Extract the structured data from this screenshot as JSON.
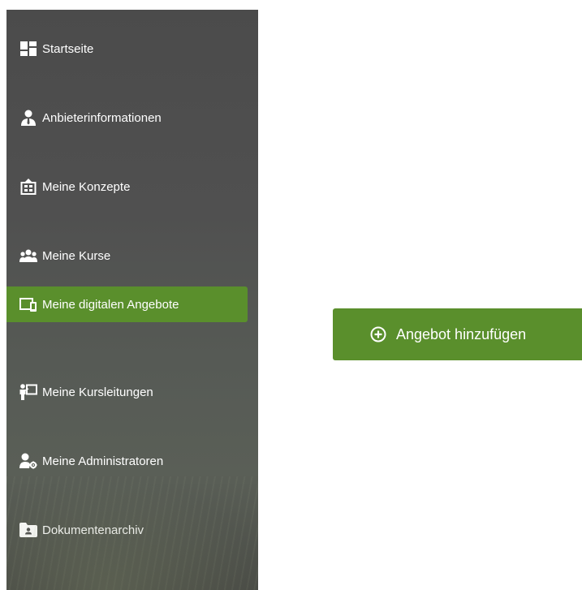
{
  "sidebar": {
    "items": [
      {
        "label": "Startseite",
        "icon": "dashboard-icon",
        "active": false
      },
      {
        "label": "Anbieterinformationen",
        "icon": "user-tie-icon",
        "active": false
      },
      {
        "label": "Meine Konzepte",
        "icon": "building-icon",
        "active": false
      },
      {
        "label": "Meine Kurse",
        "icon": "group-icon",
        "active": false
      },
      {
        "label": "Meine digitalen Angebote",
        "icon": "devices-icon",
        "active": true
      },
      {
        "label": "Meine Kursleitungen",
        "icon": "presenter-icon",
        "active": false
      },
      {
        "label": "Meine Administratoren",
        "icon": "user-gear-icon",
        "active": false
      },
      {
        "label": "Dokumentenarchiv",
        "icon": "folder-id-icon",
        "active": false
      }
    ]
  },
  "main": {
    "add_button_label": "Angebot hinzufügen",
    "add_button_icon": "plus-circle-icon"
  },
  "colors": {
    "accent": "#5a8f2c",
    "sidebar_bg": "#4f4f4f",
    "text_light": "#ffffff"
  }
}
